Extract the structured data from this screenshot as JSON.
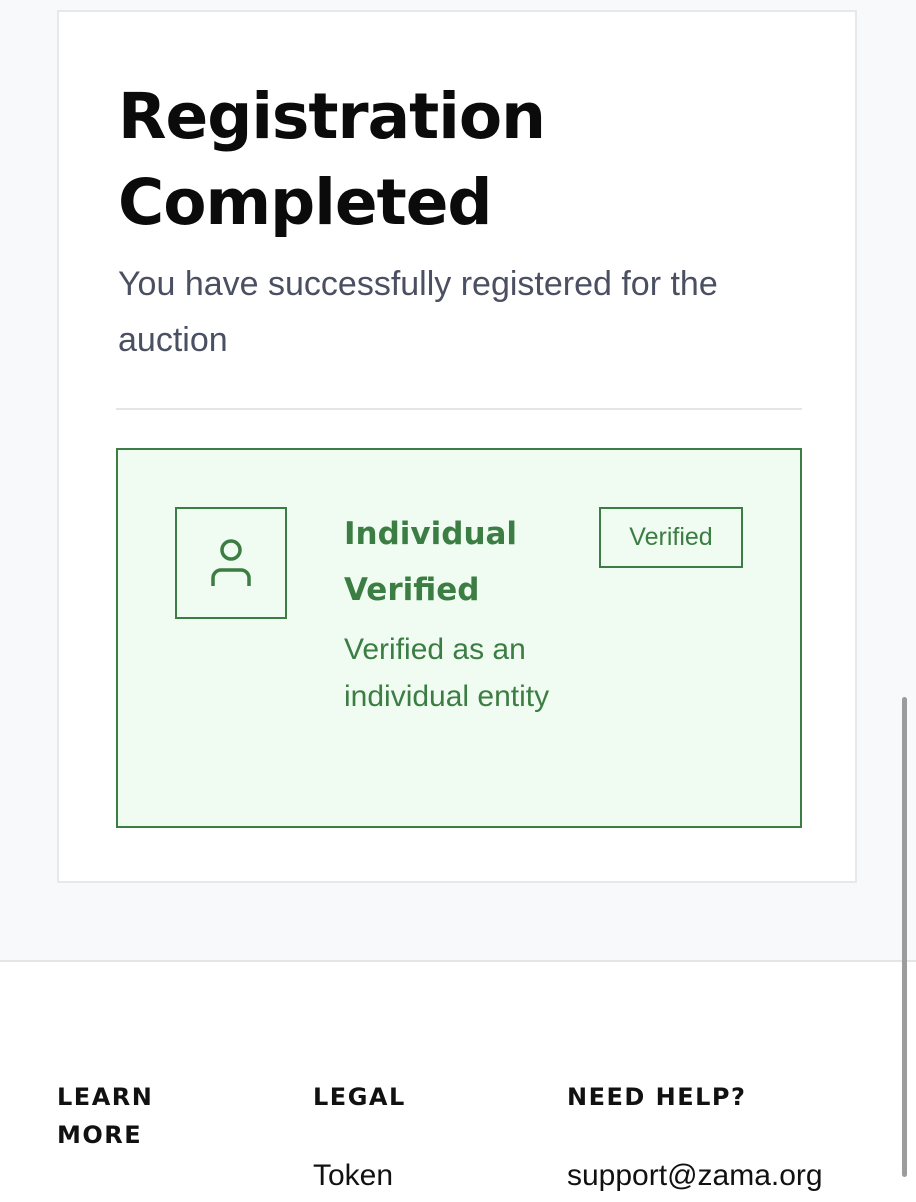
{
  "card": {
    "title_line1": "Registration",
    "title_line2": "Completed",
    "subtitle": "You have successfully registered for the auction"
  },
  "status": {
    "icon": "user-icon",
    "title": "Individual Verified",
    "description": "Verified as an individual entity",
    "badge": "Verified",
    "color": "#3b7d42",
    "background": "#f0fcf2"
  },
  "footer": {
    "columns": [
      {
        "heading": "LEARN MORE",
        "links": []
      },
      {
        "heading": "LEGAL",
        "links": [
          "Token"
        ]
      },
      {
        "heading": "NEED HELP?",
        "links": [
          "support@zama.org"
        ]
      }
    ]
  }
}
